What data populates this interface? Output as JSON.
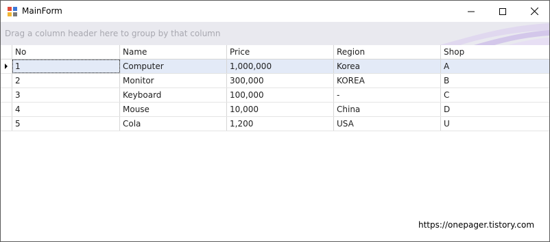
{
  "window": {
    "title": "MainForm"
  },
  "grid": {
    "group_panel_text": "Drag a column header here to group by that column",
    "columns": [
      "No",
      "Name",
      "Price",
      "Region",
      "Shop"
    ],
    "rows": [
      [
        "1",
        "Computer",
        "1,000,000",
        "Korea",
        "A"
      ],
      [
        "2",
        "Monitor",
        "300,000",
        "KOREA",
        "B"
      ],
      [
        "3",
        "Keyboard",
        "100,000",
        "-",
        "C"
      ],
      [
        "4",
        "Mouse",
        "10,000",
        "China",
        "D"
      ],
      [
        "5",
        "Cola",
        "1,200",
        "USA",
        "U"
      ]
    ],
    "selected_row": 0
  },
  "footer": {
    "link_text": "https://onepager.tistory.com"
  },
  "colors": {
    "selection": "#e3eaf7",
    "group_panel": "#e9e9ef",
    "accent_swirl": "#c9b8e8"
  }
}
